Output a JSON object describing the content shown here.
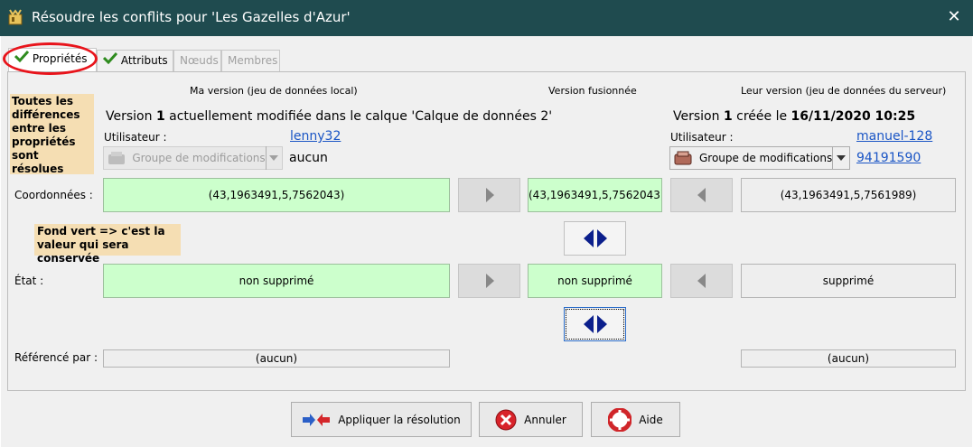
{
  "window": {
    "title": "Résoudre les conflits pour 'Les Gazelles d'Azur'",
    "close_symbol": "✕",
    "app_icon": "josm-icon"
  },
  "tabs": [
    {
      "label": "Propriétés",
      "state": "active",
      "resolved": true
    },
    {
      "label": "Attributs",
      "state": "normal",
      "resolved": true
    },
    {
      "label": "Nœuds",
      "state": "disabled",
      "resolved": false
    },
    {
      "label": "Membres",
      "state": "disabled",
      "resolved": false
    }
  ],
  "notes": {
    "resolved": "Toutes les différences entre les propriétés sont résolues",
    "green_bg": "Fond vert => c'est la valeur qui sera conservée"
  },
  "columns": {
    "mine": "Ma version (jeu de données local)",
    "merged": "Version fusionnée",
    "theirs": "Leur version (jeu de données du serveur)"
  },
  "mine": {
    "version_prefix": "Version ",
    "version_number": "1",
    "version_suffix": " actuellement modifiée dans le calque 'Calque de données 2'",
    "user_label": "Utilisateur :",
    "user": "lenny32",
    "changeset_combo": "Groupe de modifications",
    "changeset_value": "aucun"
  },
  "theirs": {
    "version_prefix": "Version ",
    "version_number": "1",
    "version_middle": " créée le ",
    "version_date": "16/11/2020 10:25",
    "user_label": "Utilisateur :",
    "user": "manuel-128",
    "changeset_combo": "Groupe de modifications",
    "changeset_value": "94191590"
  },
  "rows": {
    "coords": {
      "label": "Coordonnées :",
      "mine": "(43,1963491,5,7562043)",
      "merged": "(43,1963491,5,7562043)",
      "theirs": "(43,1963491,5,7561989)"
    },
    "state": {
      "label": "État :",
      "mine": "non supprimé",
      "merged": "non supprimé",
      "theirs": "supprimé"
    },
    "referenced": {
      "label": "Référencé par :",
      "mine": "(aucun)",
      "theirs": "(aucun)"
    }
  },
  "buttons": {
    "apply": "Appliquer la résolution",
    "cancel": "Annuler",
    "help": "Aide"
  },
  "colors": {
    "titlebar": "#1f4b4f",
    "kept_value": "#ccffcc",
    "note": "#f5deb3",
    "highlight_ellipse": "#e8141b",
    "link": "#1a55c5",
    "merge_arrow": "#0b1f8c"
  }
}
